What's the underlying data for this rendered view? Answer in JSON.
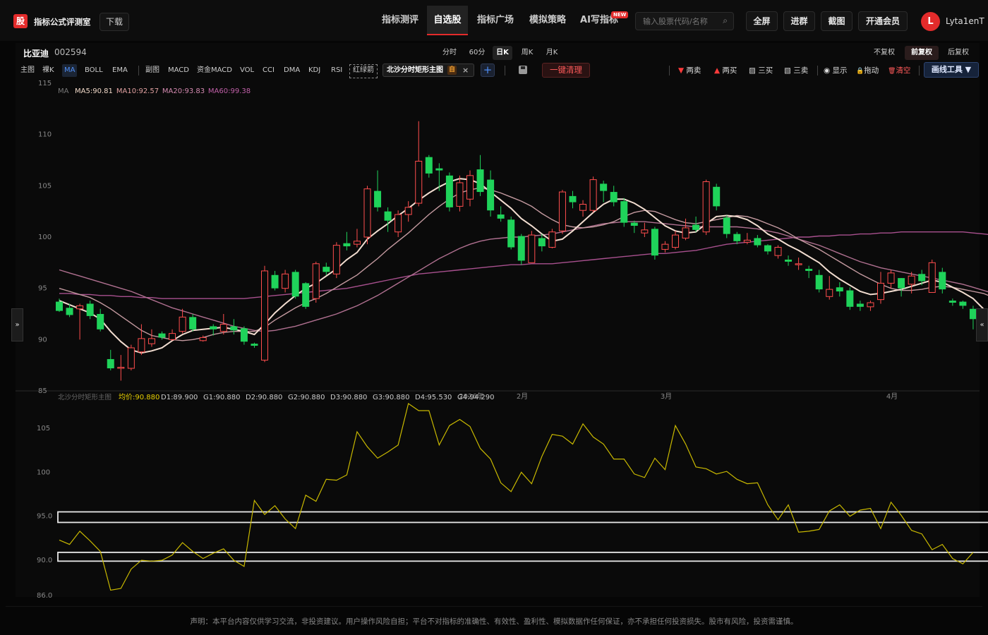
{
  "app": {
    "logo_char": "股",
    "title": "指标公式评测室",
    "download_label": "下载"
  },
  "nav": [
    {
      "label": "指标测评",
      "active": false
    },
    {
      "label": "自选股",
      "active": true
    },
    {
      "label": "指标广场",
      "active": false
    },
    {
      "label": "模拟策略",
      "active": false
    },
    {
      "label": "AI写指标",
      "active": false
    }
  ],
  "new_badge": "NEW",
  "search": {
    "placeholder": "输入股票代码/名称"
  },
  "top_buttons": [
    "全屏",
    "进群",
    "截图",
    "开通会员"
  ],
  "user": {
    "avatar_char": "L",
    "name": "Lyta1enT"
  },
  "stock": {
    "name": "比亚迪",
    "code": "002594"
  },
  "periods": [
    {
      "label": "分时",
      "active": false
    },
    {
      "label": "60分",
      "active": false
    },
    {
      "label": "日K",
      "active": true
    },
    {
      "label": "周K",
      "active": false
    },
    {
      "label": "月K",
      "active": false
    }
  ],
  "adjust": [
    {
      "label": "不复权",
      "active": false
    },
    {
      "label": "前复权",
      "active": true
    },
    {
      "label": "后复权",
      "active": false
    }
  ],
  "indicators": [
    "主图",
    "裸K",
    "MA",
    "BOLL",
    "EMA",
    "副图",
    "MACD",
    "资金MACD",
    "VOL",
    "CCI",
    "DMA",
    "KDJ",
    "RSI",
    "红绿箭"
  ],
  "active_indicator": "MA",
  "custom_indicator": {
    "label": "北沙分时矩形主图",
    "mark": "自",
    "close": "×"
  },
  "add_label": "+",
  "clear_label": "一键清理",
  "actions": [
    {
      "label": "两卖",
      "icon": "▼",
      "color": "#ff3b3b"
    },
    {
      "label": "两买",
      "icon": "▲",
      "color": "#ff3b3b"
    },
    {
      "label": "三买",
      "icon": "▨",
      "color": "#ccc"
    },
    {
      "label": "三卖",
      "icon": "▧",
      "color": "#ccc"
    },
    {
      "label": "显示",
      "icon": "◉",
      "color": "#ccc"
    },
    {
      "label": "拖动",
      "icon": "🔒",
      "color": "#e8b83a"
    },
    {
      "label": "清空",
      "icon": "🗑",
      "color": "#ff5a5a"
    }
  ],
  "draw_tool_label": "画线工具 ▼",
  "side_left": "»",
  "side_right": "«",
  "ma_legend": {
    "prefix": "MA",
    "items": [
      {
        "label": "MA5:90.81",
        "color": "#f0d8c8"
      },
      {
        "label": "MA10:92.57",
        "color": "#e0a0a0"
      },
      {
        "label": "MA20:93.83",
        "color": "#d48ab0"
      },
      {
        "label": "MA60:99.38",
        "color": "#c060a8"
      }
    ]
  },
  "sub_legend": {
    "title": "北沙分时矩形主图",
    "items": [
      {
        "label": "均价:90.880",
        "color": "#e8d000"
      },
      {
        "label": "D1:89.900",
        "color": "#ccc"
      },
      {
        "label": "G1:90.880",
        "color": "#ccc"
      },
      {
        "label": "D2:90.880",
        "color": "#ccc"
      },
      {
        "label": "G2:90.880",
        "color": "#ccc"
      },
      {
        "label": "D3:90.880",
        "color": "#ccc"
      },
      {
        "label": "G3:90.880",
        "color": "#ccc"
      },
      {
        "label": "D4:95.530",
        "color": "#ccc"
      },
      {
        "label": "G4:94.290",
        "color": "#ccc"
      }
    ]
  },
  "main_axis": {
    "ticks": [
      "115",
      "110",
      "105",
      "100",
      "95",
      "90",
      "85"
    ],
    "values": [
      115,
      110,
      105,
      100,
      95,
      90,
      85
    ]
  },
  "sub_axis": {
    "ticks": [
      "105",
      "100",
      "95.0",
      "90.0",
      "86.0"
    ],
    "values": [
      105,
      100,
      95,
      90,
      86
    ]
  },
  "month_labels": [
    "2026年",
    "2月",
    "3月",
    "4月"
  ],
  "chart_data": {
    "type": "candlestick",
    "candles": [
      [
        93.7,
        92.8,
        94.0,
        92.7
      ],
      [
        93.1,
        92.4,
        93.5,
        92.2
      ],
      [
        93.0,
        93.3,
        93.5,
        90.0
      ],
      [
        93.5,
        92.3,
        93.8,
        92.0
      ],
      [
        92.5,
        91.0,
        93.0,
        90.8
      ],
      [
        88.1,
        87.2,
        89.0,
        87.0
      ],
      [
        87.2,
        87.3,
        88.5,
        86.0
      ],
      [
        87.2,
        89.2,
        89.5,
        87.0
      ],
      [
        88.8,
        90.1,
        91.5,
        88.5
      ],
      [
        89.6,
        90.1,
        91.0,
        89.3
      ],
      [
        90.6,
        90.2,
        90.8,
        90.0
      ],
      [
        90.0,
        90.6,
        91.0,
        89.9
      ],
      [
        90.8,
        92.2,
        93.0,
        90.6
      ],
      [
        92.2,
        91.0,
        92.5,
        90.8
      ],
      [
        89.9,
        90.2,
        90.4,
        89.8
      ],
      [
        91.3,
        91.0,
        91.5,
        90.4
      ],
      [
        90.8,
        91.5,
        92.5,
        90.5
      ],
      [
        91.3,
        90.9,
        92.0,
        90.5
      ],
      [
        91.1,
        89.8,
        91.3,
        89.5
      ],
      [
        89.6,
        89.4,
        89.7,
        89.2
      ],
      [
        88.0,
        96.7,
        97.2,
        87.8
      ],
      [
        96.3,
        95.0,
        96.7,
        94.8
      ],
      [
        95.0,
        96.4,
        96.8,
        94.6
      ],
      [
        96.6,
        94.2,
        96.8,
        94.0
      ],
      [
        95.5,
        93.2,
        95.6,
        93.0
      ],
      [
        94.0,
        97.4,
        97.6,
        93.6
      ],
      [
        97.1,
        96.6,
        97.5,
        96.3
      ],
      [
        96.4,
        99.2,
        99.5,
        96.0
      ],
      [
        99.4,
        99.1,
        100.5,
        98.7
      ],
      [
        99.3,
        99.6,
        100.8,
        99.0
      ],
      [
        100.0,
        104.7,
        105.0,
        99.3
      ],
      [
        104.5,
        102.9,
        106.5,
        102.5
      ],
      [
        102.5,
        101.6,
        102.9,
        100.5
      ],
      [
        100.5,
        102.2,
        102.6,
        100.0
      ],
      [
        102.2,
        102.9,
        103.5,
        101.5
      ],
      [
        103.3,
        107.4,
        111.3,
        103.0
      ],
      [
        107.8,
        106.2,
        108.0,
        105.8
      ],
      [
        106.7,
        106.5,
        107.2,
        104.5
      ],
      [
        106.0,
        102.9,
        106.3,
        102.5
      ],
      [
        103.0,
        105.3,
        106.0,
        102.5
      ],
      [
        103.7,
        106.0,
        106.5,
        103.0
      ],
      [
        106.6,
        104.4,
        108.0,
        104.0
      ],
      [
        105.6,
        102.6,
        106.5,
        102.0
      ],
      [
        102.2,
        101.8,
        103.0,
        101.5
      ],
      [
        101.7,
        99.0,
        102.0,
        98.8
      ],
      [
        100.1,
        97.7,
        100.3,
        97.3
      ],
      [
        97.5,
        100.2,
        100.6,
        97.5
      ],
      [
        99.9,
        99.1,
        100.3,
        98.6
      ],
      [
        99.0,
        100.5,
        100.8,
        98.9
      ],
      [
        100.6,
        104.4,
        104.6,
        100.3
      ],
      [
        104.0,
        103.4,
        104.5,
        102.8
      ],
      [
        102.6,
        103.2,
        103.6,
        102.0
      ],
      [
        102.6,
        105.6,
        105.9,
        102.4
      ],
      [
        105.2,
        104.5,
        105.5,
        103.4
      ],
      [
        104.4,
        103.4,
        105.0,
        103.0
      ],
      [
        103.5,
        101.4,
        103.8,
        101.0
      ],
      [
        101.4,
        101.1,
        101.6,
        100.4
      ],
      [
        100.4,
        100.7,
        101.4,
        100.0
      ],
      [
        100.8,
        98.2,
        101.0,
        97.8
      ],
      [
        98.8,
        99.3,
        99.6,
        98.5
      ],
      [
        99.0,
        100.2,
        100.6,
        98.8
      ],
      [
        99.9,
        100.9,
        101.8,
        99.7
      ],
      [
        101.2,
        100.7,
        102.0,
        100.5
      ],
      [
        100.5,
        105.4,
        105.6,
        100.2
      ],
      [
        104.9,
        103.0,
        105.2,
        102.6
      ],
      [
        101.9,
        100.3,
        102.1,
        99.9
      ],
      [
        100.3,
        99.6,
        100.5,
        99.3
      ],
      [
        99.5,
        99.7,
        100.4,
        99.3
      ],
      [
        99.9,
        99.2,
        100.2,
        99.0
      ],
      [
        99.2,
        98.6,
        99.3,
        98.3
      ],
      [
        98.2,
        99.0,
        99.2,
        97.9
      ],
      [
        97.8,
        97.6,
        98.2,
        97.2
      ],
      [
        97.3,
        97.4,
        98.0,
        96.8
      ],
      [
        96.9,
        96.7,
        97.2,
        96.0
      ],
      [
        96.3,
        94.9,
        96.8,
        94.6
      ],
      [
        94.2,
        94.9,
        96.2,
        93.9
      ],
      [
        95.1,
        94.7,
        95.6,
        94.2
      ],
      [
        94.8,
        93.2,
        95.1,
        92.9
      ],
      [
        93.5,
        93.2,
        93.8,
        92.8
      ],
      [
        93.2,
        93.6,
        93.8,
        92.8
      ],
      [
        93.9,
        95.5,
        96.6,
        93.5
      ],
      [
        95.5,
        96.5,
        96.8,
        95.0
      ],
      [
        96.0,
        95.0,
        96.0,
        94.2
      ],
      [
        95.4,
        96.2,
        96.6,
        94.5
      ],
      [
        96.4,
        95.7,
        96.8,
        95.3
      ],
      [
        94.6,
        97.5,
        97.8,
        94.6
      ],
      [
        96.6,
        94.9,
        97.0,
        94.5
      ],
      [
        93.8,
        93.6,
        94.0,
        93.3
      ],
      [
        93.7,
        93.3,
        93.8,
        93.0
      ],
      [
        93.0,
        92.0,
        93.3,
        91.0
      ],
      [
        91.0,
        91.2,
        91.5,
        90.0
      ],
      [
        91.5,
        92.0,
        92.2,
        90.0
      ],
      [
        90.8,
        90.4,
        91.0,
        89.6
      ],
      [
        90.3,
        90.0,
        90.6,
        89.2
      ],
      [
        90.2,
        90.7,
        91.2,
        89.8
      ]
    ],
    "ma5": [
      93.8,
      93.4,
      93.0,
      92.6,
      92.0,
      90.8,
      89.8,
      89.0,
      88.7,
      88.9,
      89.2,
      89.9,
      90.5,
      90.9,
      91.0,
      91.1,
      91.2,
      91.0,
      90.8,
      90.5,
      91.5,
      92.6,
      93.5,
      94.3,
      95.0,
      95.5,
      96.2,
      96.9,
      97.8,
      98.5,
      99.8,
      100.6,
      101.3,
      102.1,
      102.8,
      103.6,
      104.3,
      104.9,
      105.4,
      105.7,
      105.6,
      105.2,
      104.4,
      103.6,
      102.8,
      101.8,
      101.1,
      100.3,
      99.6,
      99.8,
      100.6,
      101.5,
      102.4,
      103.2,
      103.7,
      103.7,
      103.3,
      102.7,
      101.9,
      101.1,
      100.6,
      100.4,
      100.5,
      101.3,
      102.0,
      102.1,
      102.0,
      101.7,
      101.1,
      100.3,
      99.8,
      99.2,
      98.7,
      98.1,
      97.5,
      96.6,
      95.9,
      95.3,
      94.7,
      94.4,
      94.5,
      94.7,
      94.9,
      95.2,
      95.5,
      95.8,
      95.6,
      95.1,
      94.6,
      94.0,
      93.0,
      92.2,
      91.4,
      90.8,
      90.7
    ],
    "ma10": [
      95.0,
      94.7,
      94.4,
      94.1,
      93.6,
      93.0,
      92.3,
      91.6,
      90.9,
      90.4,
      90.2,
      90.0,
      89.9,
      90.0,
      90.2,
      90.5,
      90.7,
      90.8,
      90.8,
      90.8,
      91.2,
      91.9,
      92.5,
      93.1,
      93.6,
      94.0,
      94.5,
      95.1,
      95.7,
      96.3,
      97.1,
      97.9,
      98.8,
      99.6,
      100.4,
      101.3,
      102.2,
      103.0,
      103.7,
      104.3,
      104.6,
      104.8,
      104.6,
      104.3,
      103.9,
      103.5,
      103.0,
      102.3,
      101.7,
      101.2,
      101.0,
      100.9,
      101.0,
      101.2,
      101.5,
      102.0,
      102.4,
      102.6,
      102.5,
      102.1,
      101.7,
      101.4,
      101.3,
      101.5,
      101.7,
      101.9,
      102.1,
      102.0,
      101.7,
      101.3,
      100.9,
      100.4,
      99.8,
      99.3,
      98.8,
      98.2,
      97.6,
      97.0,
      96.4,
      95.9,
      95.4,
      95.0,
      94.8,
      94.8,
      94.9,
      95.1,
      95.2,
      95.1,
      94.9,
      94.7,
      94.5,
      94.1,
      93.6,
      93.0,
      92.6
    ],
    "ma20": [
      96.8,
      96.5,
      96.2,
      95.9,
      95.6,
      95.3,
      95.0,
      94.7,
      94.3,
      93.9,
      93.5,
      93.1,
      92.8,
      92.5,
      92.2,
      91.9,
      91.6,
      91.3,
      91.1,
      90.9,
      90.8,
      90.9,
      91.1,
      91.3,
      91.6,
      91.9,
      92.2,
      92.5,
      92.9,
      93.3,
      93.8,
      94.3,
      94.9,
      95.5,
      96.1,
      96.7,
      97.3,
      97.9,
      98.4,
      98.9,
      99.3,
      99.6,
      99.8,
      99.9,
      100.0,
      100.0,
      100.1,
      100.2,
      100.3,
      100.5,
      100.7,
      100.9,
      101.1,
      101.3,
      101.4,
      101.5,
      101.5,
      101.5,
      101.4,
      101.3,
      101.2,
      101.1,
      101.0,
      101.0,
      101.0,
      101.0,
      101.0,
      100.9,
      100.8,
      100.6,
      100.4,
      100.1,
      99.8,
      99.5,
      99.2,
      98.8,
      98.4,
      98.0,
      97.6,
      97.3,
      97.0,
      96.8,
      96.6,
      96.4,
      96.2,
      96.0,
      95.8,
      95.6,
      95.4,
      95.1,
      94.8,
      94.5,
      94.2,
      93.9,
      93.8
    ],
    "ma60": [
      94.5,
      94.5,
      94.4,
      94.4,
      94.3,
      94.3,
      94.2,
      94.2,
      94.1,
      94.1,
      94.0,
      94.0,
      94.0,
      94.0,
      94.0,
      94.0,
      94.0,
      94.0,
      94.0,
      94.1,
      94.2,
      94.3,
      94.4,
      94.5,
      94.6,
      94.7,
      94.8,
      94.9,
      95.0,
      95.2,
      95.4,
      95.6,
      95.8,
      96.0,
      96.2,
      96.4,
      96.5,
      96.6,
      96.7,
      96.8,
      96.9,
      97.0,
      97.1,
      97.2,
      97.3,
      97.3,
      97.4,
      97.4,
      97.4,
      97.5,
      97.6,
      97.7,
      97.8,
      97.9,
      98.0,
      98.1,
      98.2,
      98.3,
      98.4,
      98.4,
      98.5,
      98.6,
      98.7,
      98.9,
      99.1,
      99.3,
      99.4,
      99.5,
      99.6,
      99.7,
      99.8,
      99.9,
      100.0,
      100.0,
      100.1,
      100.1,
      100.2,
      100.2,
      100.3,
      100.3,
      100.4,
      100.4,
      100.5,
      100.5,
      100.5,
      100.5,
      100.5,
      100.5,
      100.5,
      100.4,
      100.3,
      100.2,
      100.0,
      99.8,
      99.4
    ],
    "sub_line": [
      92.3,
      91.8,
      93.3,
      92.2,
      91.0,
      86.6,
      86.8,
      89.0,
      90.0,
      89.9,
      90.0,
      90.6,
      92.0,
      91.0,
      90.2,
      90.8,
      91.3,
      90.0,
      89.3,
      96.8,
      95.2,
      96.2,
      94.7,
      93.6,
      97.4,
      96.7,
      99.2,
      99.1,
      99.7,
      104.6,
      102.9,
      101.6,
      102.3,
      103.1,
      107.8,
      107.0,
      107.0,
      103.1,
      105.3,
      106.0,
      105.2,
      102.7,
      101.5,
      98.8,
      97.8,
      100.0,
      98.7,
      101.8,
      104.3,
      104.1,
      103.2,
      105.5,
      104.0,
      103.2,
      101.5,
      101.5,
      99.8,
      99.4,
      101.6,
      100.3,
      105.3,
      103.2,
      100.6,
      100.4,
      99.8,
      100.1,
      99.2,
      98.7,
      98.8,
      96.3,
      94.6,
      96.3,
      93.2,
      93.3,
      93.5,
      95.6,
      96.3,
      95.0,
      95.7,
      95.9,
      93.6,
      96.6,
      95.1,
      93.4,
      93.0,
      91.2,
      91.8,
      90.2,
      89.6,
      90.9
    ],
    "rectangles": [
      {
        "top": 95.5,
        "bottom": 94.3,
        "from": 0,
        "to": 94
      },
      {
        "top": 90.9,
        "bottom": 89.9,
        "from": 0,
        "to": 94
      }
    ]
  }
}
